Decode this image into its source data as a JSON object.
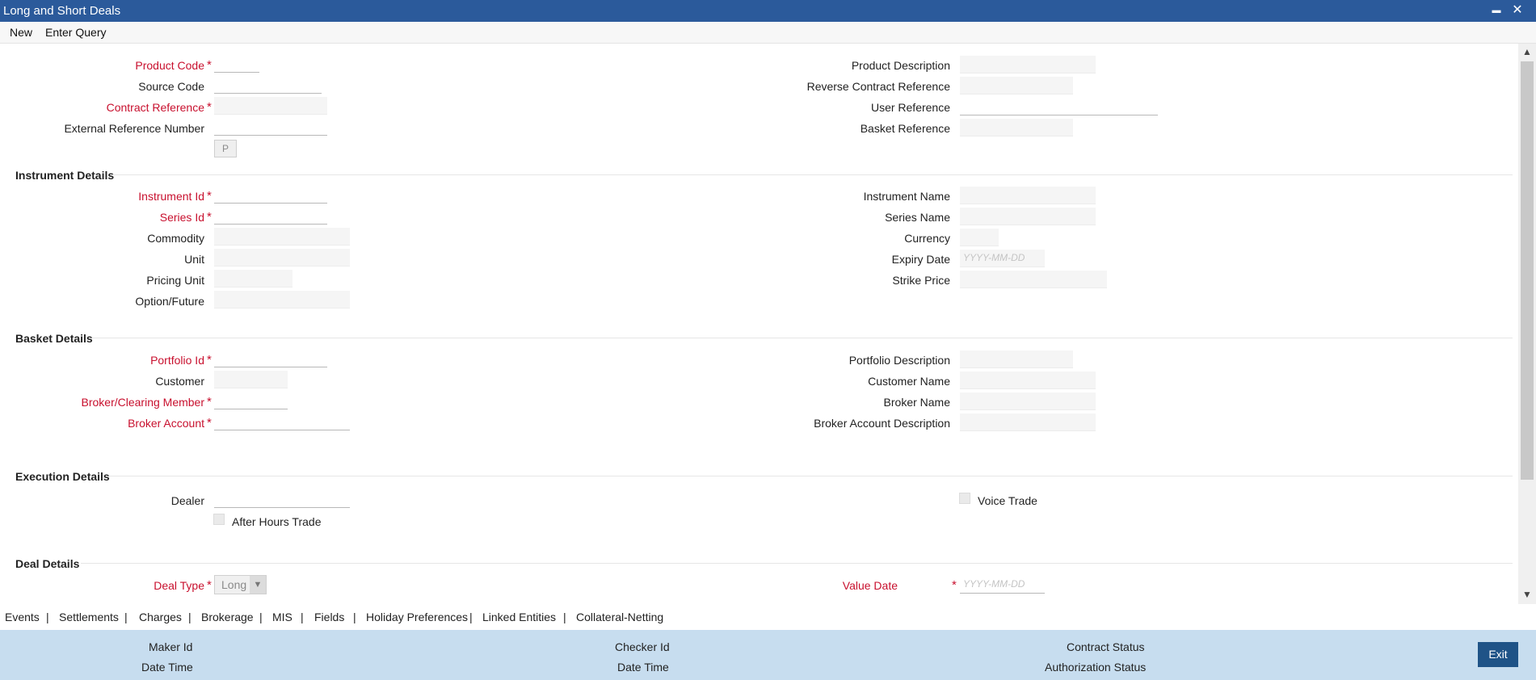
{
  "window": {
    "title": "Long and Short Deals",
    "minimize_glyph": "▬",
    "close_glyph": "✕"
  },
  "toolbar": {
    "new_label": "New",
    "enter_query_label": "Enter Query"
  },
  "header_fields": {
    "product_code": "Product Code",
    "source_code": "Source Code",
    "contract_reference": "Contract Reference",
    "external_reference_number": "External Reference Number",
    "p_button": "P",
    "product_description": "Product Description",
    "reverse_contract_reference": "Reverse Contract Reference",
    "user_reference": "User Reference",
    "basket_reference": "Basket Reference"
  },
  "instrument": {
    "section_title": "Instrument Details",
    "instrument_id": "Instrument Id",
    "series_id": "Series Id",
    "commodity": "Commodity",
    "unit": "Unit",
    "pricing_unit": "Pricing Unit",
    "option_future": "Option/Future",
    "instrument_name": "Instrument Name",
    "series_name": "Series Name",
    "currency": "Currency",
    "expiry_date": "Expiry Date",
    "strike_price": "Strike Price",
    "date_placeholder": "YYYY-MM-DD"
  },
  "basket": {
    "section_title": "Basket Details",
    "portfolio_id": "Portfolio Id",
    "customer": "Customer",
    "broker_clearing_member": "Broker/Clearing Member",
    "broker_account": "Broker Account",
    "portfolio_description": "Portfolio Description",
    "customer_name": "Customer Name",
    "broker_name": "Broker Name",
    "broker_account_description": "Broker Account Description"
  },
  "execution": {
    "section_title": "Execution Details",
    "dealer": "Dealer",
    "after_hours_trade": "After Hours Trade",
    "voice_trade": "Voice Trade"
  },
  "deal": {
    "section_title": "Deal Details",
    "deal_type": "Deal Type",
    "deal_type_value": "Long",
    "value_date": "Value Date",
    "date_placeholder": "YYYY-MM-DD"
  },
  "required_marker": "*",
  "tabs": [
    "Events",
    "Settlements",
    "Charges",
    "Brokerage",
    "MIS",
    "Fields",
    "Holiday Preferences",
    "Linked Entities",
    "Collateral-Netting"
  ],
  "tab_separator": "|",
  "footer": {
    "maker_id": "Maker Id",
    "date_time": "Date Time",
    "checker_id": "Checker Id",
    "checker_date_time": "Date Time",
    "contract_status": "Contract Status",
    "authorization_status": "Authorization Status",
    "exit_label": "Exit"
  }
}
